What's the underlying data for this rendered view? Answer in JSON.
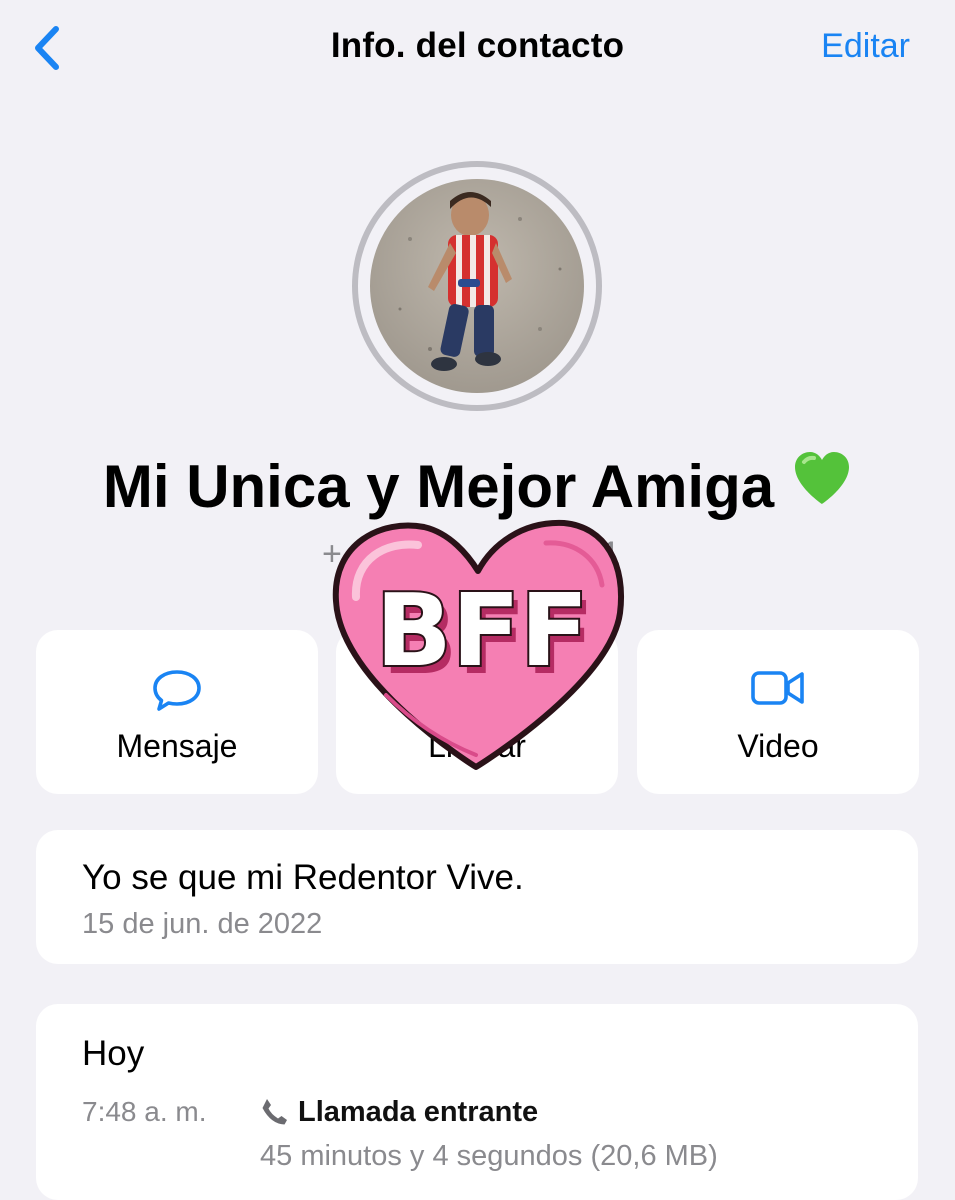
{
  "header": {
    "title": "Info. del contacto",
    "edit_label": "Editar"
  },
  "contact": {
    "name": "Mi Unica y Mejor Amiga",
    "name_emoji": "green-heart",
    "phone_visible_end": "11"
  },
  "sticker": {
    "text": "BFF"
  },
  "actions": [
    {
      "label": "Mensaje",
      "icon": "message-bubble-icon"
    },
    {
      "label": "Llamar",
      "icon": "phone-icon"
    },
    {
      "label": "Video",
      "icon": "video-camera-icon"
    }
  ],
  "about": {
    "text": "Yo se que mi Redentor Vive.",
    "date": "15 de jun. de 2022"
  },
  "call_history": {
    "day": "Hoy",
    "time": "7:48 a. m.",
    "type": "Llamada entrante",
    "detail": "45 minutos y 4 segundos (20,6 MB)"
  },
  "colors": {
    "accent": "#1a84f3",
    "background": "#f2f1f6",
    "secondary_text": "#8a8a8e",
    "sticker_pink": "#f57fb3",
    "emoji_green": "#54c23a"
  }
}
